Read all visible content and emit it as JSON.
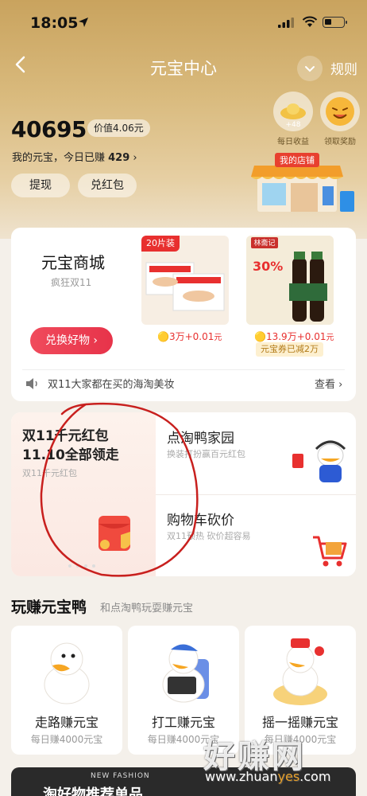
{
  "status_bar": {
    "time": "18:05"
  },
  "nav": {
    "title": "元宝中心",
    "rules_label": "规则"
  },
  "balance": {
    "amount": "40695",
    "value_badge": "价值4.06元",
    "my_label_prefix": "我的元宝，今日已赚 ",
    "today_earned": "429",
    "arrow": "›"
  },
  "actions": {
    "withdraw": "提现",
    "redeem_red_packet": "兑红包"
  },
  "rewards": [
    {
      "label": "每日收益",
      "badge": "+48"
    },
    {
      "label": "领取奖励"
    }
  ],
  "store_sign": "我的店铺",
  "mall": {
    "title": "元宝商城",
    "subtitle": "疯狂双11",
    "button": "兑换好物 ›",
    "products": [
      {
        "tag": "20片装",
        "coins": "3万",
        "plus": "+0.01",
        "unit": "元"
      },
      {
        "brand": "林斋记",
        "percent": "30%",
        "coins": "13.9万",
        "plus": "+0.01",
        "unit": "元",
        "coupon": "元宝券已减2万"
      }
    ],
    "marquee": "双11大家都在买的海淘美妆",
    "view_more": "查看"
  },
  "promos": {
    "left": {
      "title_line1": "双11千元红包",
      "title_line2": "11.10全部领走",
      "subtitle": "双11千元红包"
    },
    "right": [
      {
        "title": "点淘鸭家园",
        "subtitle": "换装打扮赢百元红包"
      },
      {
        "title": "购物车砍价",
        "subtitle": "双11预热 砍价超容易"
      }
    ]
  },
  "play": {
    "title": "玩赚元宝鸭",
    "subtitle": "和点淘鸭玩耍赚元宝",
    "tiles": [
      {
        "title": "走路赚元宝",
        "subtitle": "每日赚4000元宝"
      },
      {
        "title": "打工赚元宝",
        "subtitle": "每日赚4000元宝"
      },
      {
        "title": "摇一摇赚元宝",
        "subtitle": "每日赚4000元宝"
      }
    ]
  },
  "banner": {
    "tag": "NEW FASHION",
    "title": "淘好物推荐单品"
  },
  "watermark": {
    "text": "好赚网",
    "url_prefix": "www.zhuan",
    "url_accent": "yes",
    "url_suffix": ".com"
  }
}
